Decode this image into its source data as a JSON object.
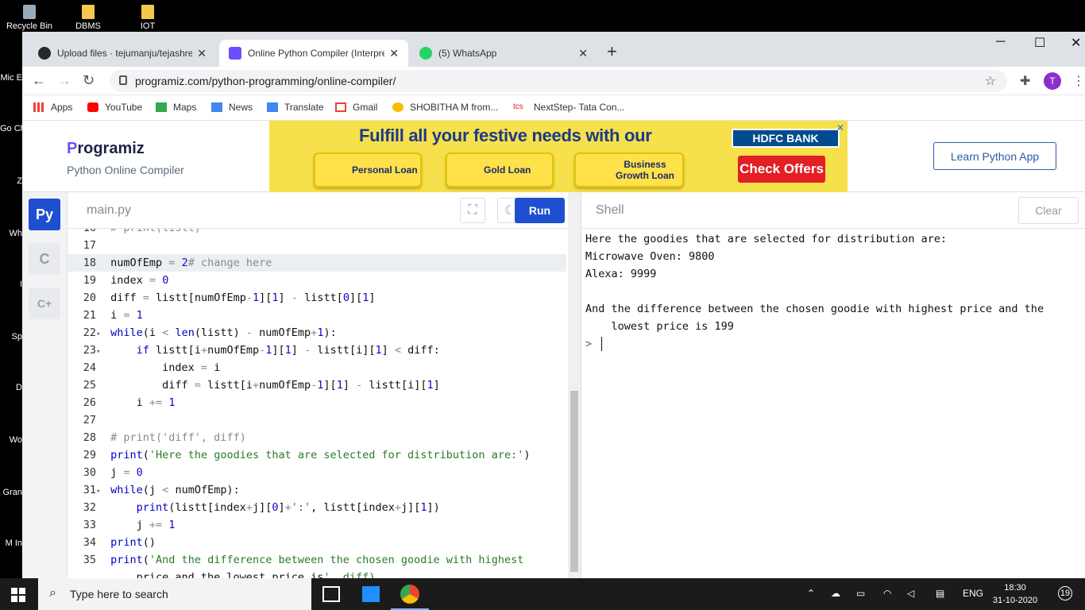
{
  "desktop": {
    "icons": [
      {
        "label": "Recycle Bin"
      },
      {
        "label": "DBMS"
      },
      {
        "label": "IOT"
      }
    ],
    "side_labels": [
      "Mic E",
      "Go Ch",
      "Z",
      "Wh",
      "I",
      "Sp",
      "D",
      "Wo",
      "Gran",
      "M In"
    ]
  },
  "browser": {
    "tabs": [
      {
        "title": "Upload files · tejumanju/tejashree",
        "active": false
      },
      {
        "title": "Online Python Compiler (Interpreter)",
        "active": true
      },
      {
        "title": "(5) WhatsApp",
        "active": false
      }
    ],
    "new_tab": "+",
    "window_controls": {
      "minimize": "─",
      "maximize": "☐",
      "close": "✕"
    },
    "url": "programiz.com/python-programming/online-compiler/",
    "avatar_letter": "T",
    "bookmarks": [
      "Apps",
      "YouTube",
      "Maps",
      "News",
      "Translate",
      "Gmail",
      "SHOBITHA M from...",
      "NextStep- Tata Con..."
    ]
  },
  "site": {
    "logo_mark": "P",
    "logo_text": "rogramiz",
    "subtitle": "Python Online Compiler",
    "learn_button": "Learn Python App",
    "ad": {
      "headline": "Fulfill all your festive needs with our",
      "items": [
        "Personal Loan",
        "Gold Loan",
        "Business Growth Loan"
      ],
      "bank": "HDFC BANK",
      "cta": "Check Offers",
      "close": "✕"
    }
  },
  "editor": {
    "filename": "main.py",
    "run_label": "Run",
    "lines": [
      {
        "n": "16",
        "code": "# print(listt)",
        "partial": true
      },
      {
        "n": "17",
        "code": ""
      },
      {
        "n": "18",
        "code": "numOfEmp = 2# change here",
        "highlight": true
      },
      {
        "n": "19",
        "code": "index = 0"
      },
      {
        "n": "20",
        "code": "diff = listt[numOfEmp-1][1] - listt[0][1]"
      },
      {
        "n": "21",
        "code": "i = 1"
      },
      {
        "n": "22",
        "code": "while(i < len(listt) - numOfEmp+1):",
        "fold": true
      },
      {
        "n": "23",
        "code": "    if listt[i+numOfEmp-1][1] - listt[i][1] < diff:",
        "fold": true
      },
      {
        "n": "24",
        "code": "        index = i"
      },
      {
        "n": "25",
        "code": "        diff = listt[i+numOfEmp-1][1] - listt[i][1]"
      },
      {
        "n": "26",
        "code": "    i += 1"
      },
      {
        "n": "27",
        "code": ""
      },
      {
        "n": "28",
        "code": "# print('diff', diff)"
      },
      {
        "n": "29",
        "code": "print('Here the goodies that are selected for distribution are:')"
      },
      {
        "n": "30",
        "code": "j = 0"
      },
      {
        "n": "31",
        "code": "while(j < numOfEmp):",
        "fold": true
      },
      {
        "n": "32",
        "code": "    print(listt[index+j][0]+':', listt[index+j][1])"
      },
      {
        "n": "33",
        "code": "    j += 1"
      },
      {
        "n": "34",
        "code": "print()"
      },
      {
        "n": "35",
        "code": "print('And the difference between the chosen goodie with highest"
      },
      {
        "n": "",
        "code": "    price and the lowest price is', diff)",
        "partial": true
      }
    ]
  },
  "shell": {
    "title": "Shell",
    "clear_label": "Clear",
    "output": [
      "Here the goodies that are selected for distribution are:",
      "Microwave Oven: 9800",
      "Alexa: 9999",
      "",
      "And the difference between the chosen goodie with highest price and the",
      "    lowest price is 199",
      "> "
    ]
  },
  "taskbar": {
    "search_placeholder": "Type here to search",
    "language": "ENG",
    "time": "18:30",
    "date": "31-10-2020",
    "notifications": "19"
  },
  "colors": {
    "run": "#1f4fd1",
    "ad_bg": "#f6e04b",
    "hdfc": "#004c8f",
    "offers": "#e31e24",
    "python_icon": "#1f4fd1"
  }
}
